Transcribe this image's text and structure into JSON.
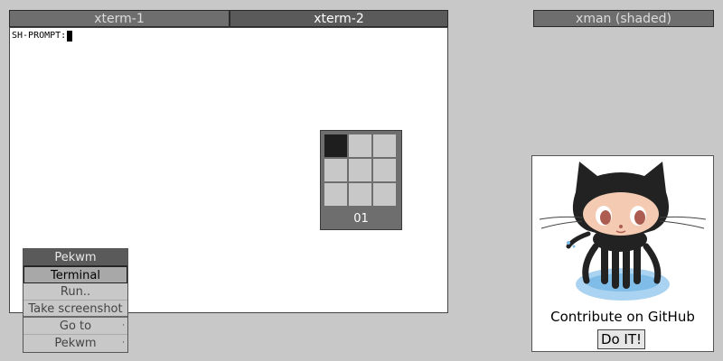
{
  "tabs": [
    {
      "label": "xterm-1",
      "active": false
    },
    {
      "label": "xterm-2",
      "active": true
    }
  ],
  "shaded_window": {
    "label": "xman (shaded)"
  },
  "terminal": {
    "prompt": "SH-PROMPT:"
  },
  "pager": {
    "label": "01",
    "current_desktop": 1
  },
  "root_menu": {
    "title": "Pekwm",
    "items": [
      {
        "label": "Terminal",
        "selected": true
      },
      {
        "label": "Run..",
        "selected": false
      },
      {
        "label": "Take screenshot",
        "selected": false
      },
      {
        "label": "Go to",
        "submenu": true
      },
      {
        "label": "Pekwm",
        "submenu": true
      }
    ],
    "submenu_marker": "·"
  },
  "github_widget": {
    "caption": "Contribute on GitHub",
    "button_label": "Do IT!"
  },
  "colors": {
    "desktop_bg": "#c8c8c8",
    "titlebar": "#6e6e6e",
    "titlebar_active": "#5a5a5a"
  }
}
